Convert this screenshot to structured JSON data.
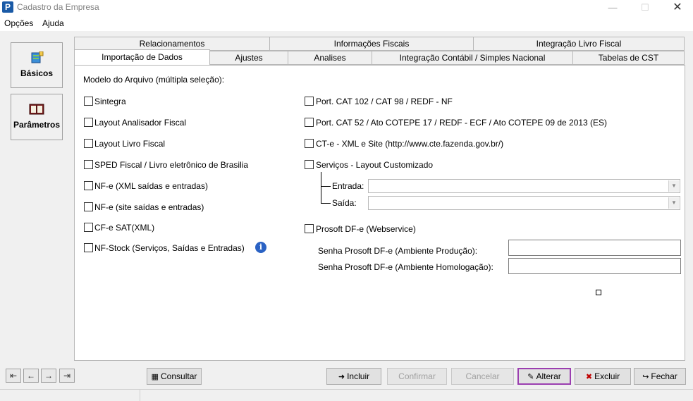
{
  "window": {
    "title": "Cadastro da Empresa",
    "icon_letter": "P"
  },
  "menu": {
    "items": [
      "Opções",
      "Ajuda"
    ]
  },
  "nav": {
    "basicos": "Básicos",
    "parametros": "Parâmetros"
  },
  "tabs": {
    "row1": [
      "Relacionamentos",
      "Informações Fiscais",
      "Integração Livro Fiscal"
    ],
    "row2": [
      "Importação de Dados",
      "Ajustes",
      "Analises",
      "Integração Contábil / Simples Nacional",
      "Tabelas de CST"
    ],
    "active": "Importação de Dados"
  },
  "form": {
    "heading": "Modelo do Arquivo (múltipla seleção):",
    "left_options": [
      "Sintegra",
      "Layout Analisador Fiscal",
      "Layout Livro Fiscal",
      "SPED Fiscal / Livro eletrônico de Brasilia",
      "NF-e (XML saídas e entradas)",
      "NF-e (site saídas e entradas)",
      "CF-e SAT(XML)",
      "NF-Stock (Serviços, Saídas e Entradas)"
    ],
    "right_options": [
      "Port. CAT 102 / CAT 98 / REDF - NF",
      "Port. CAT 52 / Ato COTEPE 17 / REDF - ECF / Ato COTEPE 09 de 2013 (ES)",
      "CT-e - XML e Site (http://www.cte.fazenda.gov.br/)",
      "Serviços - Layout Customizado"
    ],
    "entrada_label": "Entrada:",
    "saida_label": "Saída:",
    "prosoft_label": "Prosoft DF-e (Webservice)",
    "senha_producao_label": "Senha Prosoft DF-e (Ambiente Produção):",
    "senha_homologacao_label": "Senha Prosoft DF-e (Ambiente Homologação):",
    "entrada_value": "",
    "saida_value": "",
    "senha_producao_value": "",
    "senha_homologacao_value": ""
  },
  "buttons": {
    "consultar": "Consultar",
    "incluir": "Incluir",
    "confirmar": "Confirmar",
    "cancelar": "Cancelar",
    "alterar": "Alterar",
    "excluir": "Excluir",
    "fechar": "Fechar"
  },
  "icons": {
    "nav_first": "first-record-icon",
    "nav_prev": "previous-record-icon",
    "nav_next": "next-record-icon",
    "nav_last": "last-record-icon"
  },
  "colors": {
    "focus_border": "#9b3fb0",
    "info_icon": "#2a62c4"
  }
}
